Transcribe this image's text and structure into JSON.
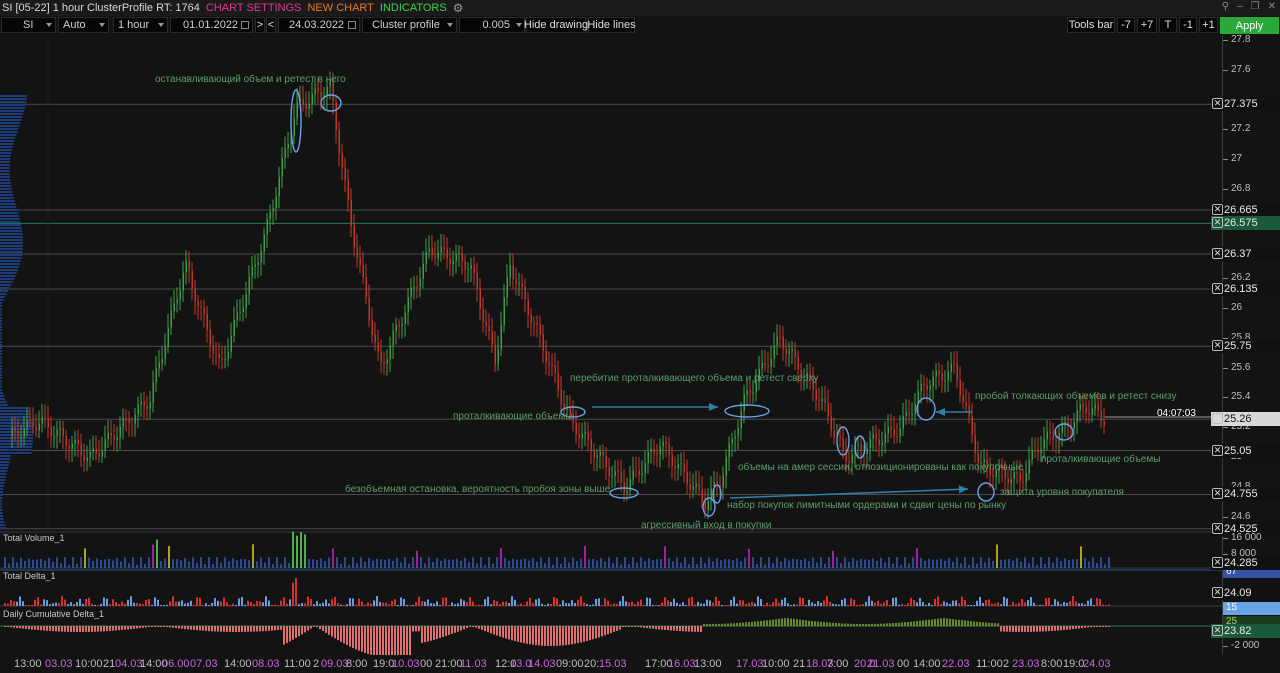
{
  "titlebar": {
    "title": "SI [05-22] 1 hour ClusterProfile RT: 1764",
    "menu_chart_settings": "CHART SETTINGS",
    "menu_new_chart": "NEW CHART",
    "menu_indicators": "INDICATORS"
  },
  "toolbar": {
    "symbol": "SI",
    "mode": "Auto",
    "timeframe": "1 hour",
    "date_from": "01.01.2022",
    "next": ">",
    "prev": "<",
    "date_to": "24.03.2022",
    "chart_type": "Cluster profile",
    "step": "0.005",
    "hide_drawing": "Hide drawing",
    "hide_lines": "Hide lines",
    "tools_bar": "Tools bar",
    "minus7": "-7",
    "plus7": "+7",
    "t": "T",
    "minus1": "-1",
    "plus1": "+1",
    "apply": "Apply"
  },
  "price_axis": {
    "ticks": [
      {
        "label": "27.8",
        "price": 27.8
      },
      {
        "label": "27.6",
        "price": 27.6
      },
      {
        "label": "27.2",
        "price": 27.2
      },
      {
        "label": "27",
        "price": 27.0
      },
      {
        "label": "26.8",
        "price": 26.8
      },
      {
        "label": "26.2",
        "price": 26.2
      },
      {
        "label": "26",
        "price": 26.0
      },
      {
        "label": "25.8",
        "price": 25.8
      },
      {
        "label": "25.6",
        "price": 25.6
      },
      {
        "label": "25.4",
        "price": 25.4
      },
      {
        "label": "25.2",
        "price": 25.2
      },
      {
        "label": "25",
        "price": 25.0
      },
      {
        "label": "24.8",
        "price": 24.8
      },
      {
        "label": "24.6",
        "price": 24.6
      }
    ],
    "horizontal_lines": [
      {
        "label": "27.375",
        "price": 27.375,
        "color": "#4a4a4a"
      },
      {
        "label": "26.665",
        "price": 26.665,
        "color": "#4a4a4a"
      },
      {
        "label": "26.575",
        "price": 26.575,
        "color": "#1f7a55"
      },
      {
        "label": "26.37",
        "price": 26.37,
        "color": "#4a4a4a"
      },
      {
        "label": "26.135",
        "price": 26.135,
        "color": "#4a4a4a"
      },
      {
        "label": "25.75",
        "price": 25.75,
        "color": "#4a4a4a"
      },
      {
        "label": "25.26",
        "price": 25.26,
        "color": "#4a4a4a"
      },
      {
        "label": "25.05",
        "price": 25.05,
        "color": "#4a4a4a"
      },
      {
        "label": "24.755",
        "price": 24.755,
        "color": "#4a4a4a"
      },
      {
        "label": "24.525",
        "price": 24.525,
        "color": "#4a4a4a"
      }
    ],
    "current_price": "25.26",
    "timer": "04:07:03"
  },
  "indicators": {
    "volume": {
      "title": "Total Volume_1",
      "tick_top": "16 000",
      "tick_mid": "8 000",
      "value_badge": "67",
      "line_label": "24.285"
    },
    "delta": {
      "title": "Total Delta_1",
      "line_label": "24.09",
      "value_badge": "15"
    },
    "cum_delta": {
      "title": "Daily Cumulative Delta_1",
      "value_badge": "25",
      "line_label": "23.82",
      "tick_bottom": "-2 000"
    }
  },
  "annotations": [
    "останавливающий объем и ретест в него",
    "перебитие проталкивающего объема и ретест сверху",
    "проталкивающие объемы",
    "объемы на амер сессии, отпозиционированы как покупочные",
    "пробой толкающих объемов и ретест снизу",
    "проталкивающие объемы",
    "безобъемная остановка, вероятность пробоя зоны выше",
    "набор покупок лимитными ордерами и сдвиг цены по рынку",
    "защита уровня покупателя",
    "агрессивный вход в покупки"
  ],
  "time_axis": [
    {
      "text": "13:00",
      "kind": "time"
    },
    {
      "text": "03.03",
      "kind": "date"
    },
    {
      "text": "10:00",
      "kind": "time"
    },
    {
      "text": "21",
      "kind": "time"
    },
    {
      "text": "04.03",
      "kind": "date"
    },
    {
      "text": "14:00",
      "kind": "time"
    },
    {
      "text": "06.00",
      "kind": "date"
    },
    {
      "text": "07.03",
      "kind": "date"
    },
    {
      "text": "14:00",
      "kind": "time"
    },
    {
      "text": "08.03",
      "kind": "date"
    },
    {
      "text": "11:00",
      "kind": "time"
    },
    {
      "text": "2",
      "kind": "time"
    },
    {
      "text": "09.03",
      "kind": "date"
    },
    {
      "text": "8:00",
      "kind": "time"
    },
    {
      "text": "19:0",
      "kind": "time"
    },
    {
      "text": "10.03",
      "kind": "date"
    },
    {
      "text": "00",
      "kind": "time"
    },
    {
      "text": "21:00",
      "kind": "time"
    },
    {
      "text": "11.03",
      "kind": "date"
    },
    {
      "text": "12:0",
      "kind": "time"
    },
    {
      "text": "13.0",
      "kind": "date"
    },
    {
      "text": "14.03",
      "kind": "date"
    },
    {
      "text": "09:00",
      "kind": "time"
    },
    {
      "text": "20:",
      "kind": "time"
    },
    {
      "text": "15.03",
      "kind": "date"
    },
    {
      "text": "17:00",
      "kind": "time"
    },
    {
      "text": "16.03",
      "kind": "date"
    },
    {
      "text": "13:00",
      "kind": "time"
    },
    {
      "text": "17.03",
      "kind": "date"
    },
    {
      "text": "10:00",
      "kind": "time"
    },
    {
      "text": "21",
      "kind": "time"
    },
    {
      "text": "18.03",
      "kind": "date"
    },
    {
      "text": "7:00",
      "kind": "time"
    },
    {
      "text": "20.0",
      "kind": "date"
    },
    {
      "text": "21.03",
      "kind": "date"
    },
    {
      "text": "00",
      "kind": "time"
    },
    {
      "text": "14:00",
      "kind": "time"
    },
    {
      "text": "22.03",
      "kind": "date"
    },
    {
      "text": "11:00",
      "kind": "time"
    },
    {
      "text": "2",
      "kind": "time"
    },
    {
      "text": "23.03",
      "kind": "date"
    },
    {
      "text": "8:00",
      "kind": "time"
    },
    {
      "text": "19:0",
      "kind": "time"
    },
    {
      "text": "24.03",
      "kind": "date"
    }
  ]
}
